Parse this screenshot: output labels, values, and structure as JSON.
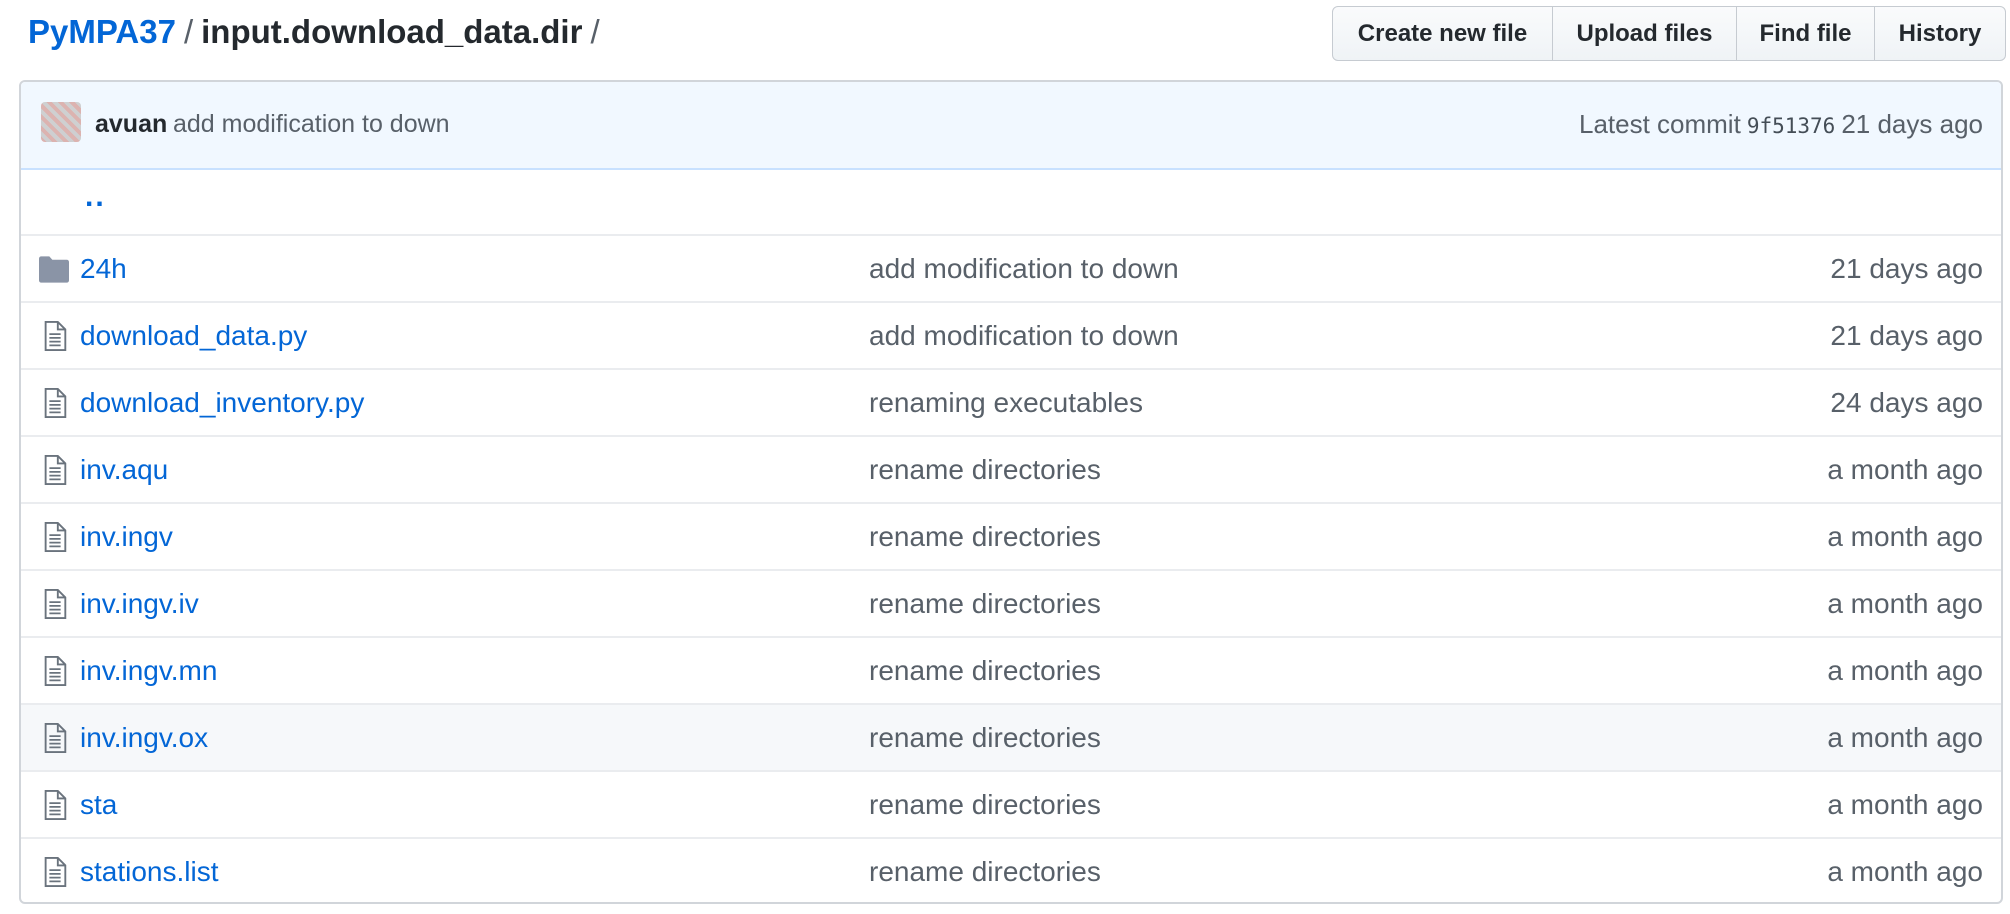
{
  "breadcrumb": {
    "repo": "PyMPA37",
    "separator": "/",
    "directory": "input.download_data.dir",
    "trailing": "/"
  },
  "toolbar": {
    "create_label": "Create new file",
    "upload_label": "Upload files",
    "find_label": "Find file",
    "history_label": "History"
  },
  "commit": {
    "author": "avuan",
    "message": "add modification to down",
    "prefix": "Latest commit",
    "sha": "9f51376",
    "age": "21 days ago"
  },
  "parent_link": "..",
  "files": [
    {
      "name": "24h",
      "type": "folder",
      "message": "add modification to down",
      "age": "21 days ago"
    },
    {
      "name": "download_data.py",
      "type": "file",
      "message": "add modification to down",
      "age": "21 days ago"
    },
    {
      "name": "download_inventory.py",
      "type": "file",
      "message": "renaming executables",
      "age": "24 days ago"
    },
    {
      "name": "inv.aqu",
      "type": "file",
      "message": "rename directories",
      "age": "a month ago"
    },
    {
      "name": "inv.ingv",
      "type": "file",
      "message": "rename directories",
      "age": "a month ago"
    },
    {
      "name": "inv.ingv.iv",
      "type": "file",
      "message": "rename directories",
      "age": "a month ago"
    },
    {
      "name": "inv.ingv.mn",
      "type": "file",
      "message": "rename directories",
      "age": "a month ago"
    },
    {
      "name": "inv.ingv.ox",
      "type": "file",
      "message": "rename directories",
      "age": "a month ago"
    },
    {
      "name": "sta",
      "type": "file",
      "message": "rename directories",
      "age": "a month ago"
    },
    {
      "name": "stations.list",
      "type": "file",
      "message": "rename directories",
      "age": "a month ago"
    }
  ],
  "colors": {
    "link": "#0366d6",
    "muted": "#586069",
    "commit_bar": "#f1f8ff",
    "folder_icon": "#79b8ff",
    "file_icon": "#6a737d"
  }
}
